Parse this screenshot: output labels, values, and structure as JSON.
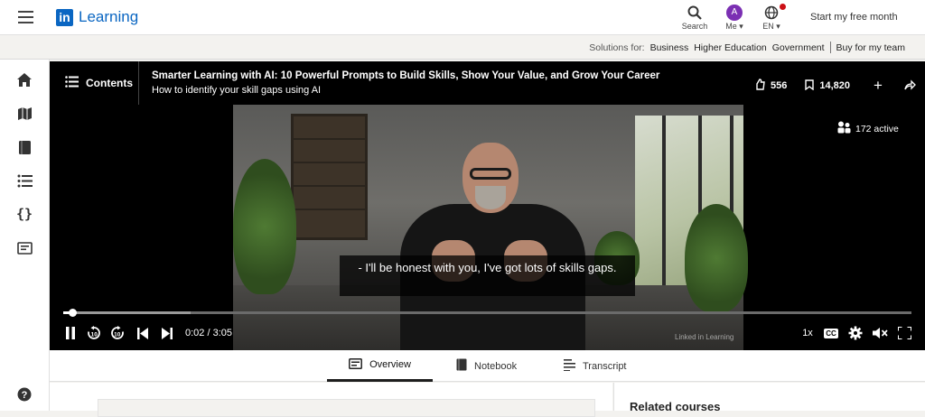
{
  "header": {
    "logo_mark": "in",
    "logo_text": "Learning",
    "search_label": "Search",
    "me_initial": "A",
    "me_label": "Me",
    "lang_label": "EN",
    "start_free": "Start my free month"
  },
  "solutions": {
    "prefix": "Solutions for:",
    "business": "Business",
    "higher_ed": "Higher Education",
    "government": "Government",
    "buy": "Buy for my team"
  },
  "sidebar": {
    "items": [
      "home-icon",
      "map-icon",
      "book-icon",
      "list-icon",
      "code-icon",
      "certificate-icon",
      "help-icon"
    ]
  },
  "player": {
    "contents_label": "Contents",
    "course_title": "Smarter Learning with AI: 10 Powerful Prompts to Build Skills, Show Your Value, and Grow Your Career",
    "lesson_title": "How to identify your skill gaps using AI",
    "likes": "556",
    "saves": "14,820",
    "active_viewers": "172 active",
    "caption": "- I'll be honest with you, I've got lots of skills gaps.",
    "time": "0:02 / 3:05",
    "progress_fraction": 0.011,
    "buffered_fraction": 0.15,
    "speed": "1x",
    "cc": "CC",
    "watermark": "Linked in Learning"
  },
  "tabs": [
    {
      "label": "Overview",
      "active": true
    },
    {
      "label": "Notebook",
      "active": false
    },
    {
      "label": "Transcript",
      "active": false
    }
  ],
  "related": {
    "heading": "Related courses"
  },
  "colors": {
    "brand": "#0a66c2",
    "avatar": "#7b2fb3",
    "notification": "#cc1016"
  }
}
